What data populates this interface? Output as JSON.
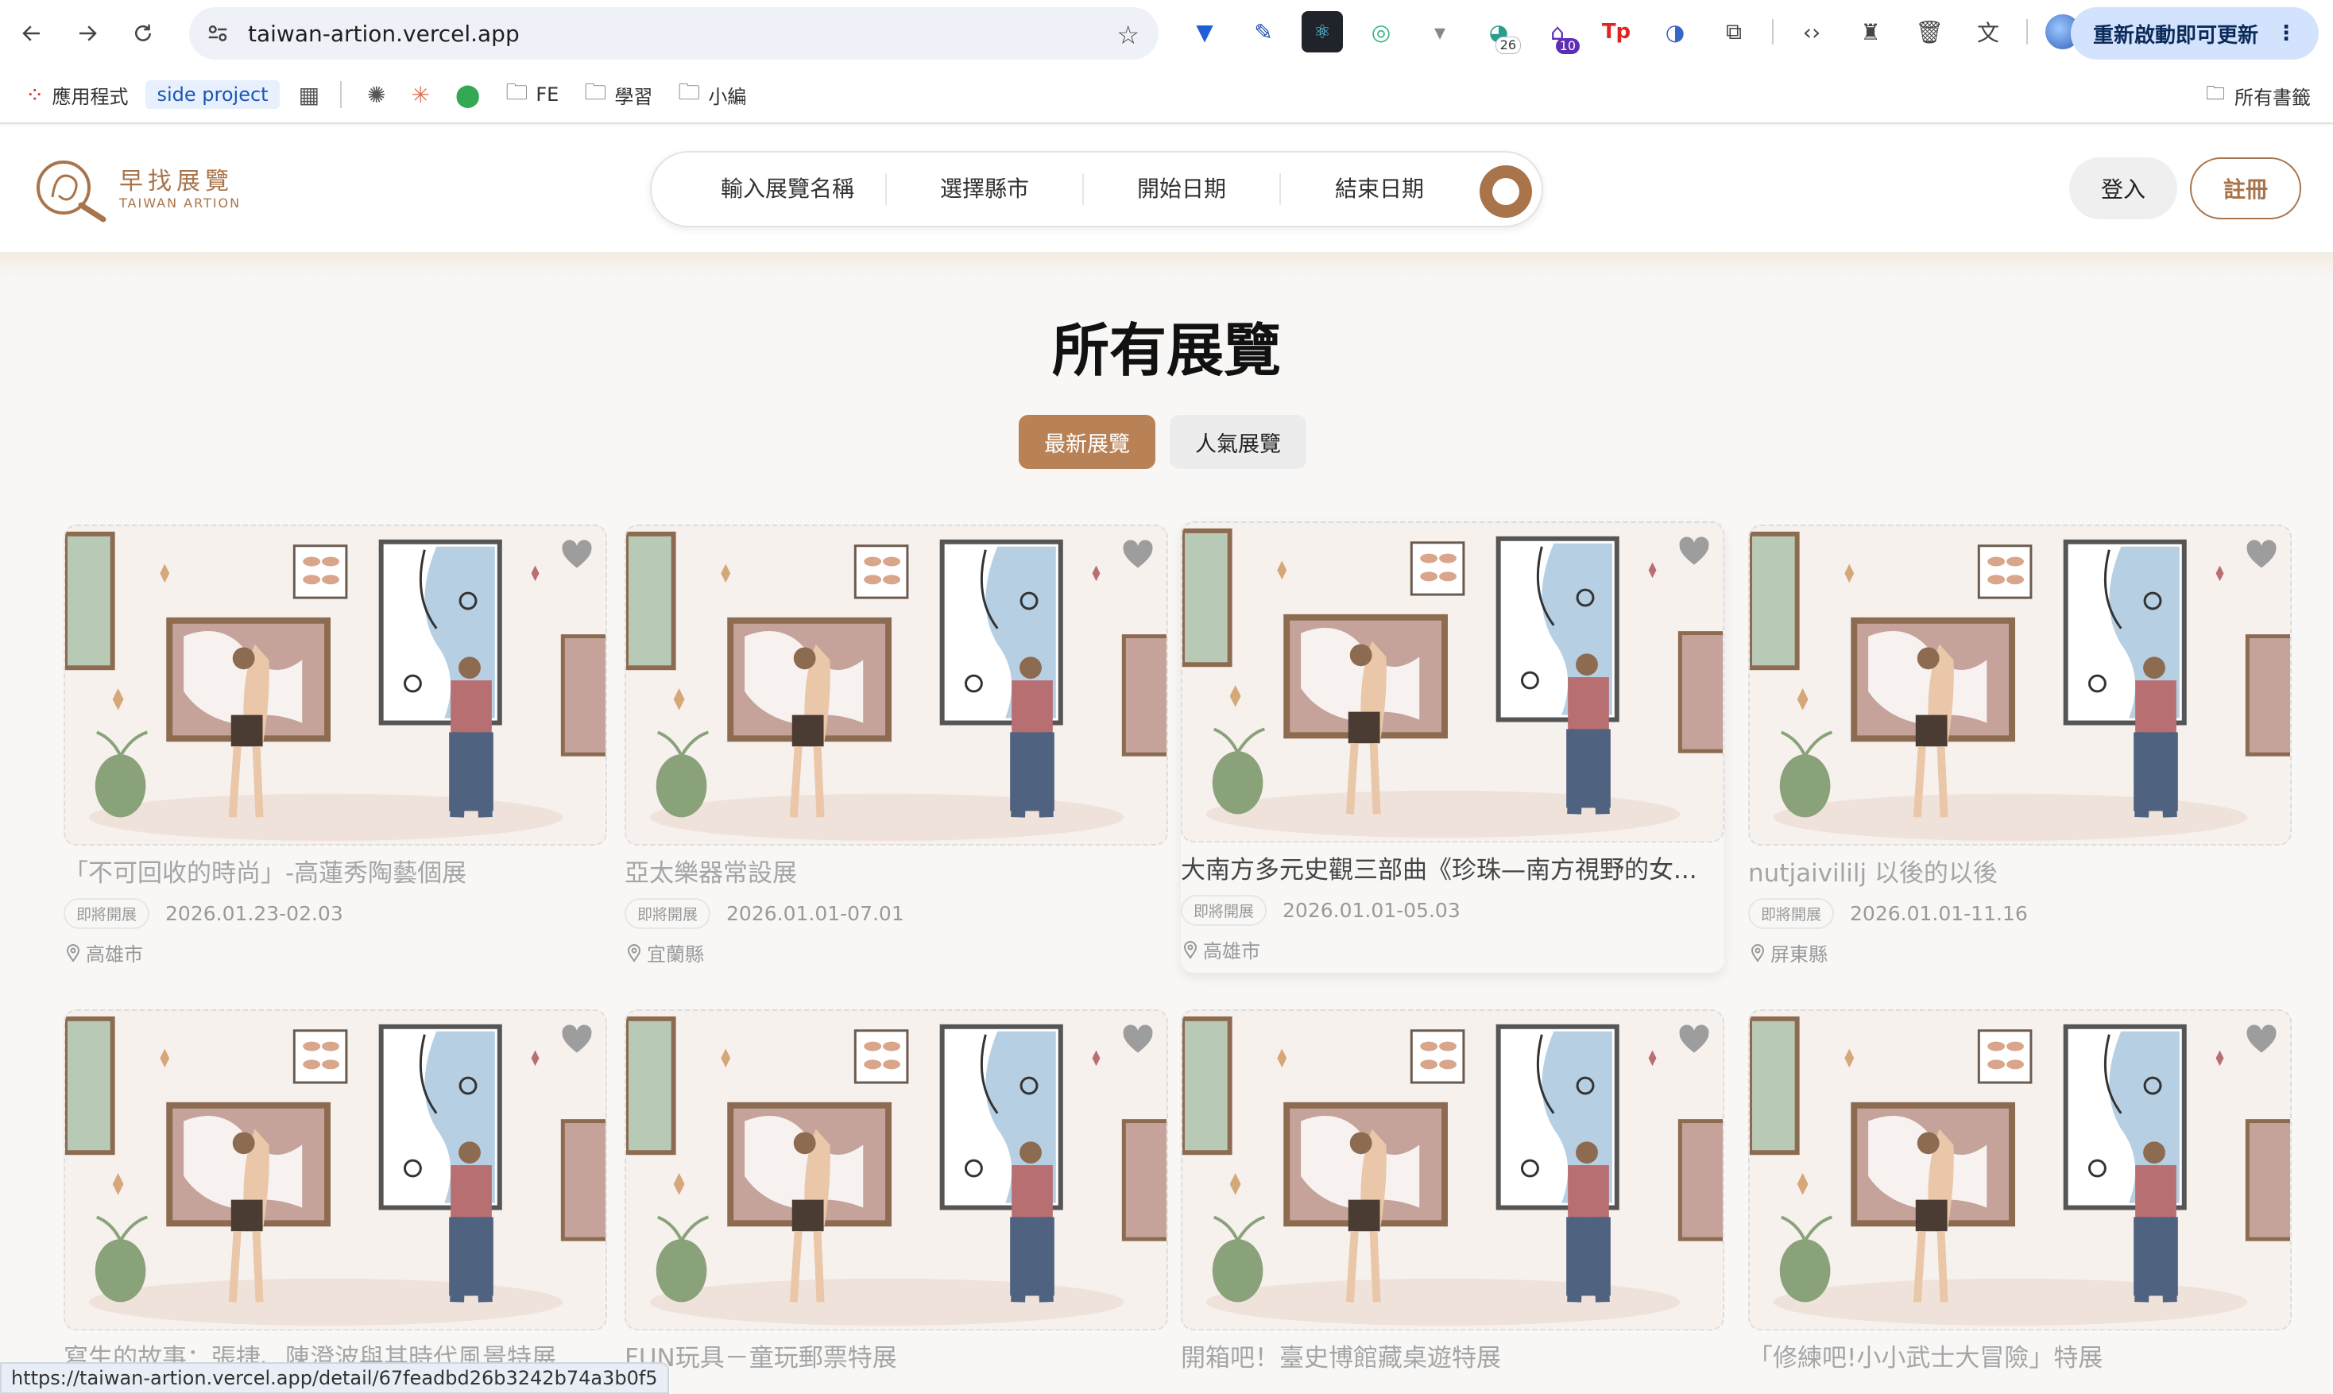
{
  "browser": {
    "url": "taiwan-artion.vercel.app",
    "update_label": "重新啟動即可更新",
    "extension_badges": {
      "b1": "26",
      "b2": "10"
    },
    "ext_text": "Tp"
  },
  "bookmarks": {
    "apps": "應用程式",
    "side_project": "side project",
    "fe": "FE",
    "study": "學習",
    "editor": "小編",
    "all": "所有書籤"
  },
  "site": {
    "logo_title": "早找展覽",
    "logo_sub": "TAIWAN ARTION",
    "search": {
      "name": "輸入展覽名稱",
      "city": "選擇縣市",
      "start": "開始日期",
      "end": "結束日期"
    },
    "login": "登入",
    "signup": "註冊",
    "accent": "#a9744a"
  },
  "main": {
    "title": "所有展覽",
    "tabs": [
      "最新展覽",
      "人氣展覽"
    ],
    "cards": [
      {
        "title": "「不可回收的時尚」-高蓮秀陶藝個展",
        "tag": "即將開展",
        "date": "2026.01.23-02.03",
        "location": "高雄市"
      },
      {
        "title": "亞太樂器常設展",
        "tag": "即將開展",
        "date": "2026.01.01-07.01",
        "location": "宜蘭縣"
      },
      {
        "title": "大南方多元史觀三部曲《珍珠—南方視野的女...",
        "tag": "即將開展",
        "date": "2026.01.01-05.03",
        "location": "高雄市"
      },
      {
        "title": "nutjaivililj 以後的以後",
        "tag": "即將開展",
        "date": "2026.01.01-11.16",
        "location": "屏東縣"
      },
      {
        "title": "寫生的故事：張捷、陳澄波與其時代風景特展",
        "tag": "",
        "date": "",
        "location": ""
      },
      {
        "title": "FUN玩具－童玩郵票特展",
        "tag": "",
        "date": "",
        "location": ""
      },
      {
        "title": "開箱吧！臺史博館藏桌遊特展",
        "tag": "",
        "date": "",
        "location": ""
      },
      {
        "title": "「修練吧!小小武士大冒險」特展",
        "tag": "",
        "date": "",
        "location": ""
      }
    ]
  },
  "status_url": "https://taiwan-artion.vercel.app/detail/67feadbd26b3242b74a3b0f5"
}
